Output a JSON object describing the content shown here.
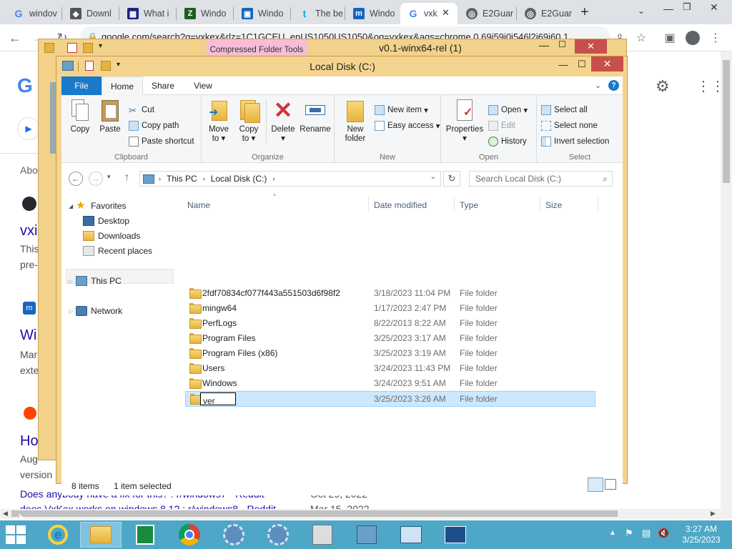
{
  "browser": {
    "tabs": [
      {
        "label": "windov",
        "icon": "google-icon",
        "color": "#4285f4"
      },
      {
        "label": "Downl",
        "icon": "shield-icon",
        "color": "#555555"
      },
      {
        "label": "What i",
        "icon": "site-icon",
        "color": "#1a237e"
      },
      {
        "label": "Windo",
        "icon": "windows-icon",
        "color": "#1b5e20"
      },
      {
        "label": "Windo",
        "icon": "windows-icon",
        "color": "#1565c0"
      },
      {
        "label": "The be",
        "icon": "t-icon",
        "color": "#00aced"
      },
      {
        "label": "Windo",
        "icon": "m-icon",
        "color": "#1565c0"
      },
      {
        "label": "vxk",
        "icon": "google-icon",
        "color": "#4285f4",
        "active": true
      },
      {
        "label": "E2Guar",
        "icon": "globe-icon",
        "color": "#5f6368"
      },
      {
        "label": "E2Guar",
        "icon": "globe-icon",
        "color": "#5f6368"
      }
    ],
    "url": "google.com/search?q=vxkex&rlz=1C1GCEU_enUS1050US1050&oq=vxkex&aqs=chrome.0.69i59j0i546l2j69i60.1",
    "page_snippets": {
      "about": "Abo",
      "r1_title": "vxi",
      "r1_text1": "This",
      "r1_text2": "pre-",
      "r2_title": "Wi",
      "r2_text1": "Mar",
      "r2_text2": "exte",
      "r3_title": "Ho",
      "r3_text1": "Aug",
      "r3_text2": "version",
      "reddit_link": "Does anybody have a fix for this? : r/windows7 - Reddit",
      "reddit_date": "Oct 29, 2022",
      "bottom_partial": "does VxKex works on windows 8.1? : r/windows8 - Reddit",
      "bottom_date": "Mar 15, 2022"
    }
  },
  "back_window": {
    "contextual_tab": "Compressed Folder Tools",
    "title": "v0.1-winx64-rel (1)"
  },
  "explorer": {
    "title": "Local Disk (C:)",
    "ribbon_tabs": [
      "File",
      "Home",
      "Share",
      "View"
    ],
    "clipboard": {
      "copy": "Copy",
      "paste": "Paste",
      "cut": "Cut",
      "copy_path": "Copy path",
      "paste_shortcut": "Paste shortcut",
      "label": "Clipboard"
    },
    "organize": {
      "move_to": "Move",
      "move_to2": "to",
      "copy_to": "Copy",
      "copy_to2": "to",
      "delete": "Delete",
      "rename": "Rename",
      "label": "Organize"
    },
    "new": {
      "new_folder": "New",
      "new_folder2": "folder",
      "new_item": "New item",
      "easy_access": "Easy access",
      "label": "New"
    },
    "open": {
      "properties": "Properties",
      "open": "Open",
      "edit": "Edit",
      "history": "History",
      "label": "Open"
    },
    "select": {
      "select_all": "Select all",
      "select_none": "Select none",
      "invert": "Invert selection",
      "label": "Select"
    },
    "breadcrumb": [
      "This PC",
      "Local Disk (C:)"
    ],
    "search_placeholder": "Search Local Disk (C:)",
    "nav": {
      "favorites": "Favorites",
      "desktop": "Desktop",
      "downloads": "Downloads",
      "recent": "Recent places",
      "this_pc": "This PC",
      "network": "Network"
    },
    "columns": [
      "Name",
      "Date modified",
      "Type",
      "Size"
    ],
    "files": [
      {
        "name": "2fdf70834cf077f443a551503d6f98f2",
        "date": "3/18/2023 11:04 PM",
        "type": "File folder"
      },
      {
        "name": "mingw64",
        "date": "1/17/2023 2:47 PM",
        "type": "File folder"
      },
      {
        "name": "PerfLogs",
        "date": "8/22/2013 8:22 AM",
        "type": "File folder"
      },
      {
        "name": "Program Files",
        "date": "3/25/2023 3:17 AM",
        "type": "File folder"
      },
      {
        "name": "Program Files (x86)",
        "date": "3/25/2023 3:19 AM",
        "type": "File folder"
      },
      {
        "name": "Users",
        "date": "3/24/2023 11:43 PM",
        "type": "File folder"
      },
      {
        "name": "Windows",
        "date": "3/24/2023 9:51 AM",
        "type": "File folder"
      }
    ],
    "renaming": {
      "value": "ver",
      "date": "3/25/2023 3:26 AM",
      "type": "File folder"
    },
    "status": {
      "items": "8 items",
      "selected": "1 item selected"
    }
  },
  "taskbar": {
    "time": "3:27 AM",
    "date": "3/25/2023"
  }
}
